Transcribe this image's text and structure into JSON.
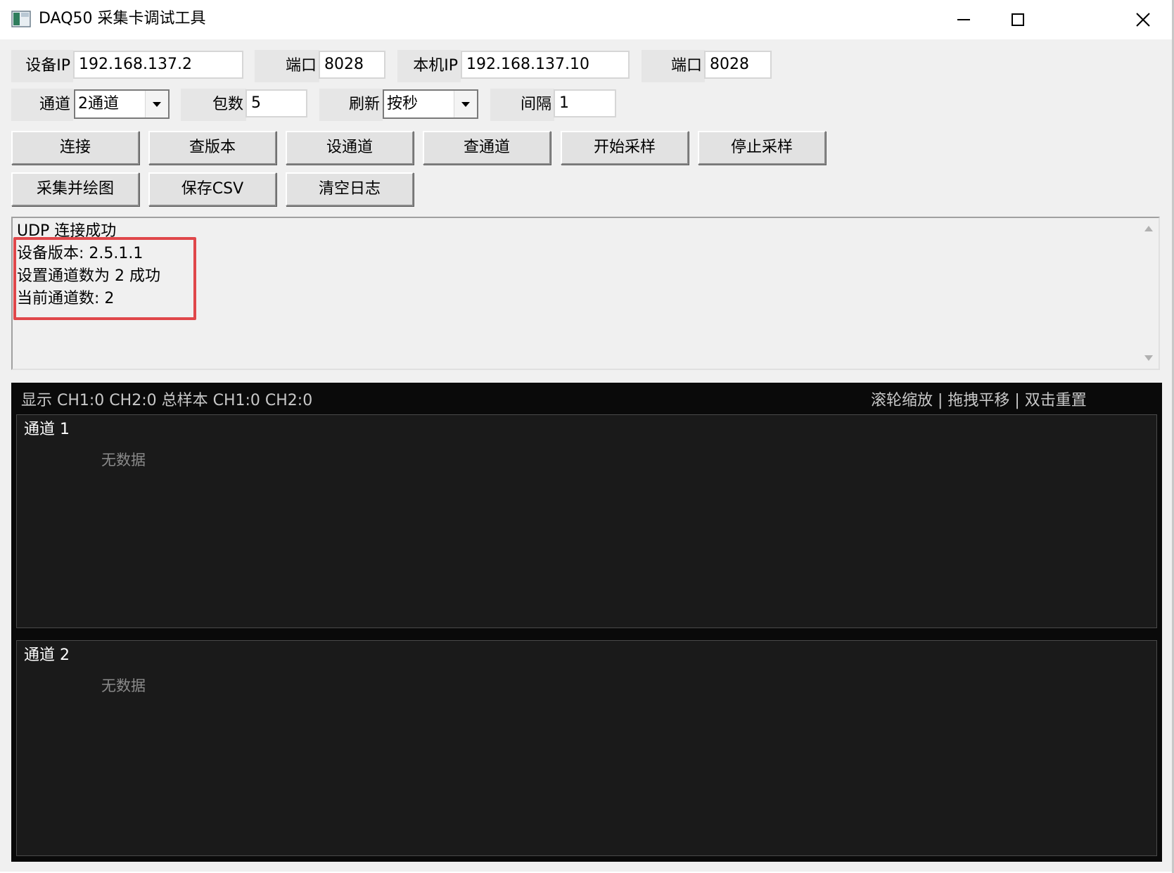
{
  "window": {
    "title": "DAQ50 采集卡调试工具",
    "controls": [
      "minimize-icon",
      "maximize-icon",
      "close-icon"
    ]
  },
  "config": {
    "device_ip": {
      "label": "设备IP",
      "value": "192.168.137.2"
    },
    "device_port": {
      "label": "端口",
      "value": "8028"
    },
    "local_ip": {
      "label": "本机IP",
      "value": "192.168.137.10"
    },
    "local_port": {
      "label": "端口",
      "value": "8028"
    },
    "channel": {
      "label": "通道",
      "selected": "2通道"
    },
    "packets": {
      "label": "包数",
      "value": "5"
    },
    "refresh": {
      "label": "刷新",
      "selected": "按秒"
    },
    "interval": {
      "label": "间隔",
      "value": "1"
    }
  },
  "buttons": {
    "connect": "连接",
    "query_version": "查版本",
    "set_channel": "设通道",
    "query_channel": "查通道",
    "start_sampling": "开始采样",
    "stop_sampling": "停止采样",
    "sample_and_plot": "采集并绘图",
    "save_csv": "保存CSV",
    "clear_log": "清空日志"
  },
  "log": {
    "lines": [
      "UDP 连接成功",
      "设备版本: 2.5.1.1",
      "设置通道数为 2 成功",
      "当前通道数: 2"
    ],
    "highlight_color": "#e0474a"
  },
  "plot": {
    "status": "显示 CH1:0  CH2:0  总样本 CH1:0  CH2:0",
    "hint": "滚轮缩放 | 拖拽平移 | 双击重置",
    "channels": [
      {
        "title": "通道 1",
        "empty_text": "无数据"
      },
      {
        "title": "通道 2",
        "empty_text": "无数据"
      }
    ],
    "background": "#0a0a0a",
    "panel_color": "#1a1a1a"
  }
}
